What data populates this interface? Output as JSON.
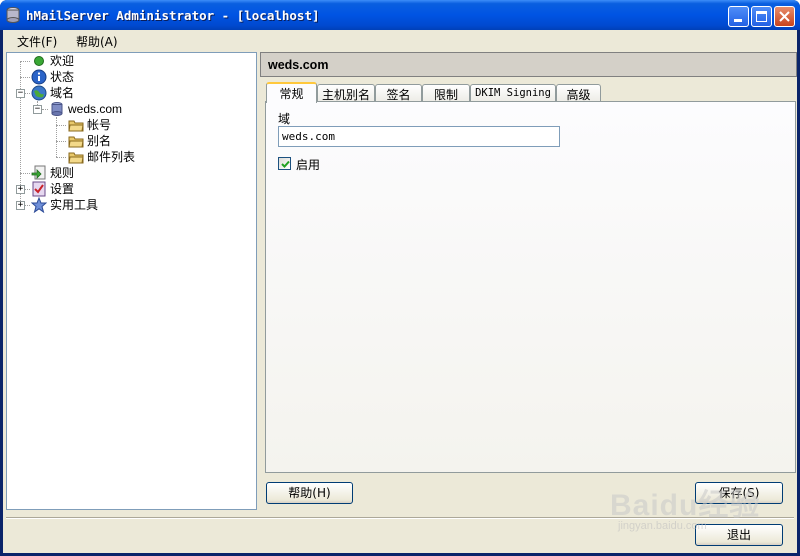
{
  "window": {
    "title": "hMailServer Administrator - [localhost]"
  },
  "menu": {
    "file_label": "文件(F)",
    "help_label": "帮助(A)"
  },
  "tree": {
    "items": [
      {
        "label": "欢迎",
        "icon": "green-dot-icon"
      },
      {
        "label": "状态",
        "icon": "info-icon"
      },
      {
        "label": "域名",
        "icon": "globe-icon"
      },
      {
        "label": "weds.com",
        "icon": "database-icon"
      },
      {
        "label": "帐号",
        "icon": "folder-icon"
      },
      {
        "label": "别名",
        "icon": "folder-icon"
      },
      {
        "label": "邮件列表",
        "icon": "folder-icon"
      },
      {
        "label": "规则",
        "icon": "rules-icon"
      },
      {
        "label": "设置",
        "icon": "checklist-icon"
      },
      {
        "label": "实用工具",
        "icon": "star-icon"
      }
    ]
  },
  "main": {
    "header_title": "weds.com",
    "tabs": [
      {
        "label": "常规"
      },
      {
        "label": "主机别名"
      },
      {
        "label": "签名"
      },
      {
        "label": "限制"
      },
      {
        "label": "DKIM Signing"
      },
      {
        "label": "高级"
      }
    ],
    "domain_label": "域",
    "domain_value": "weds.com",
    "enabled_label": "启用",
    "enabled_checked": true
  },
  "buttons": {
    "help_label": "帮助(H)",
    "save_label": "保存(S)",
    "exit_label": "退出"
  },
  "watermark": {
    "text": "Baidu经验",
    "sub": "jingyan.baidu.com"
  }
}
